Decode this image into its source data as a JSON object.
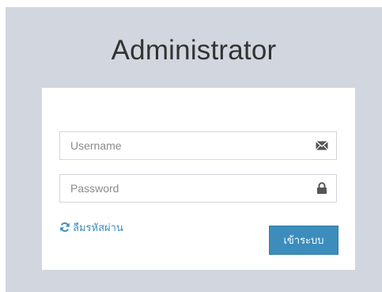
{
  "header": {
    "title": "Administrator"
  },
  "login_form": {
    "username": {
      "value": "",
      "placeholder": "Username",
      "icon": "envelope-icon"
    },
    "password": {
      "value": "",
      "placeholder": "Password",
      "icon": "lock-icon"
    },
    "forgot_password": {
      "label": "ลืมรหัสผ่าน",
      "icon": "refresh-icon"
    },
    "submit": {
      "label": "เข้าระบบ"
    }
  },
  "colors": {
    "background_panel": "#d2d6de",
    "accent": "#3c8dbc",
    "card": "#ffffff"
  }
}
